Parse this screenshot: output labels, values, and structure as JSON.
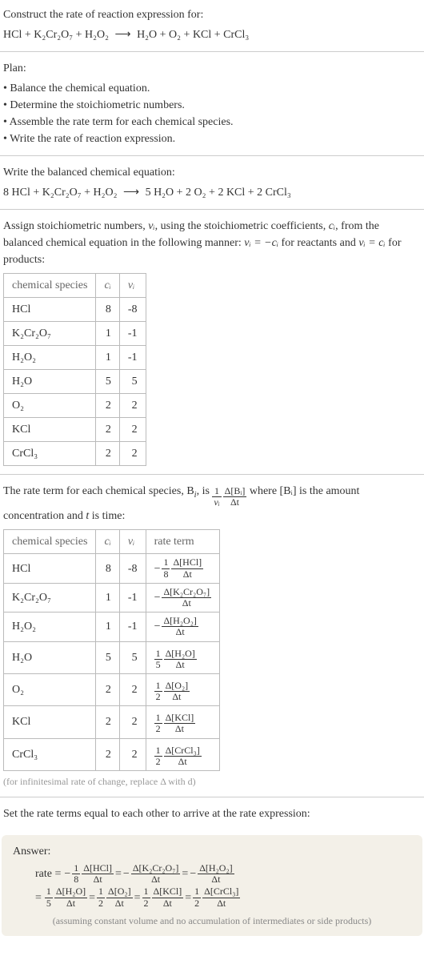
{
  "construct": {
    "title": "Construct the rate of reaction expression for:",
    "equation_lhs": "HCl + K₂Cr₂O₇ + H₂O₂",
    "arrow": "⟶",
    "equation_rhs": "H₂O + O₂ + KCl + CrCl₃"
  },
  "plan": {
    "title": "Plan:",
    "items": [
      "Balance the chemical equation.",
      "Determine the stoichiometric numbers.",
      "Assemble the rate term for each chemical species.",
      "Write the rate of reaction expression."
    ]
  },
  "balanced": {
    "title": "Write the balanced chemical equation:",
    "lhs": "8 HCl + K₂Cr₂O₇ + H₂O₂",
    "arrow": "⟶",
    "rhs": "5 H₂O + 2 O₂ + 2 KCl + 2 CrCl₃"
  },
  "assign": {
    "text_a": "Assign stoichiometric numbers, ",
    "nu_i": "νᵢ",
    "text_b": ", using the stoichiometric coefficients, ",
    "c_i": "cᵢ",
    "text_c": ", from the balanced chemical equation in the following manner: ",
    "rel1": "νᵢ = −cᵢ",
    "text_d": " for reactants and ",
    "rel2": "νᵢ = cᵢ",
    "text_e": " for products:"
  },
  "table1": {
    "headers": {
      "species": "chemical species",
      "ci": "cᵢ",
      "nui": "νᵢ"
    },
    "rows": [
      {
        "species": "HCl",
        "ci": "8",
        "nui": "-8"
      },
      {
        "species": "K₂Cr₂O₇",
        "ci": "1",
        "nui": "-1"
      },
      {
        "species": "H₂O₂",
        "ci": "1",
        "nui": "-1"
      },
      {
        "species": "H₂O",
        "ci": "5",
        "nui": "5"
      },
      {
        "species": "O₂",
        "ci": "2",
        "nui": "2"
      },
      {
        "species": "KCl",
        "ci": "2",
        "nui": "2"
      },
      {
        "species": "CrCl₃",
        "ci": "2",
        "nui": "2"
      }
    ]
  },
  "rate_term_sentence": {
    "a": "The rate term for each chemical species, B",
    "b": ", is ",
    "one": "1",
    "nu": "νᵢ",
    "dBi_top": "Δ[Bᵢ]",
    "dBi_bot": "Δt",
    "c": " where [Bᵢ] is the amount concentration and ",
    "t": "t",
    "d": " is time:"
  },
  "table2": {
    "headers": {
      "species": "chemical species",
      "ci": "cᵢ",
      "nui": "νᵢ",
      "rate": "rate term"
    },
    "rows": [
      {
        "species": "HCl",
        "ci": "8",
        "nui": "-8",
        "sign": "−",
        "coef_top": "1",
        "coef_bot": "8",
        "d_top": "Δ[HCl]",
        "d_bot": "Δt"
      },
      {
        "species": "K₂Cr₂O₇",
        "ci": "1",
        "nui": "-1",
        "sign": "−",
        "coef_top": "",
        "coef_bot": "",
        "d_top": "Δ[K₂Cr₂O₇]",
        "d_bot": "Δt"
      },
      {
        "species": "H₂O₂",
        "ci": "1",
        "nui": "-1",
        "sign": "−",
        "coef_top": "",
        "coef_bot": "",
        "d_top": "Δ[H₂O₂]",
        "d_bot": "Δt"
      },
      {
        "species": "H₂O",
        "ci": "5",
        "nui": "5",
        "sign": "",
        "coef_top": "1",
        "coef_bot": "5",
        "d_top": "Δ[H₂O]",
        "d_bot": "Δt"
      },
      {
        "species": "O₂",
        "ci": "2",
        "nui": "2",
        "sign": "",
        "coef_top": "1",
        "coef_bot": "2",
        "d_top": "Δ[O₂]",
        "d_bot": "Δt"
      },
      {
        "species": "KCl",
        "ci": "2",
        "nui": "2",
        "sign": "",
        "coef_top": "1",
        "coef_bot": "2",
        "d_top": "Δ[KCl]",
        "d_bot": "Δt"
      },
      {
        "species": "CrCl₃",
        "ci": "2",
        "nui": "2",
        "sign": "",
        "coef_top": "1",
        "coef_bot": "2",
        "d_top": "Δ[CrCl₃]",
        "d_bot": "Δt"
      }
    ]
  },
  "delta_note": "(for infinitesimal rate of change, replace Δ with d)",
  "set_equal": "Set the rate terms equal to each other to arrive at the rate expression:",
  "answer": {
    "label": "Answer:",
    "rate_prefix": "rate =",
    "eq2_prefix": "=",
    "terms_line1": [
      {
        "sign": "−",
        "coef_top": "1",
        "coef_bot": "8",
        "d_top": "Δ[HCl]",
        "d_bot": "Δt",
        "tail": " = "
      },
      {
        "sign": "−",
        "coef_top": "",
        "coef_bot": "",
        "d_top": "Δ[K₂Cr₂O₇]",
        "d_bot": "Δt",
        "tail": " = "
      },
      {
        "sign": "−",
        "coef_top": "",
        "coef_bot": "",
        "d_top": "Δ[H₂O₂]",
        "d_bot": "Δt",
        "tail": ""
      }
    ],
    "terms_line2": [
      {
        "sign": "",
        "coef_top": "1",
        "coef_bot": "5",
        "d_top": "Δ[H₂O]",
        "d_bot": "Δt",
        "tail": " = "
      },
      {
        "sign": "",
        "coef_top": "1",
        "coef_bot": "2",
        "d_top": "Δ[O₂]",
        "d_bot": "Δt",
        "tail": " = "
      },
      {
        "sign": "",
        "coef_top": "1",
        "coef_bot": "2",
        "d_top": "Δ[KCl]",
        "d_bot": "Δt",
        "tail": " = "
      },
      {
        "sign": "",
        "coef_top": "1",
        "coef_bot": "2",
        "d_top": "Δ[CrCl₃]",
        "d_bot": "Δt",
        "tail": ""
      }
    ],
    "assumption": "(assuming constant volume and no accumulation of intermediates or side products)"
  }
}
